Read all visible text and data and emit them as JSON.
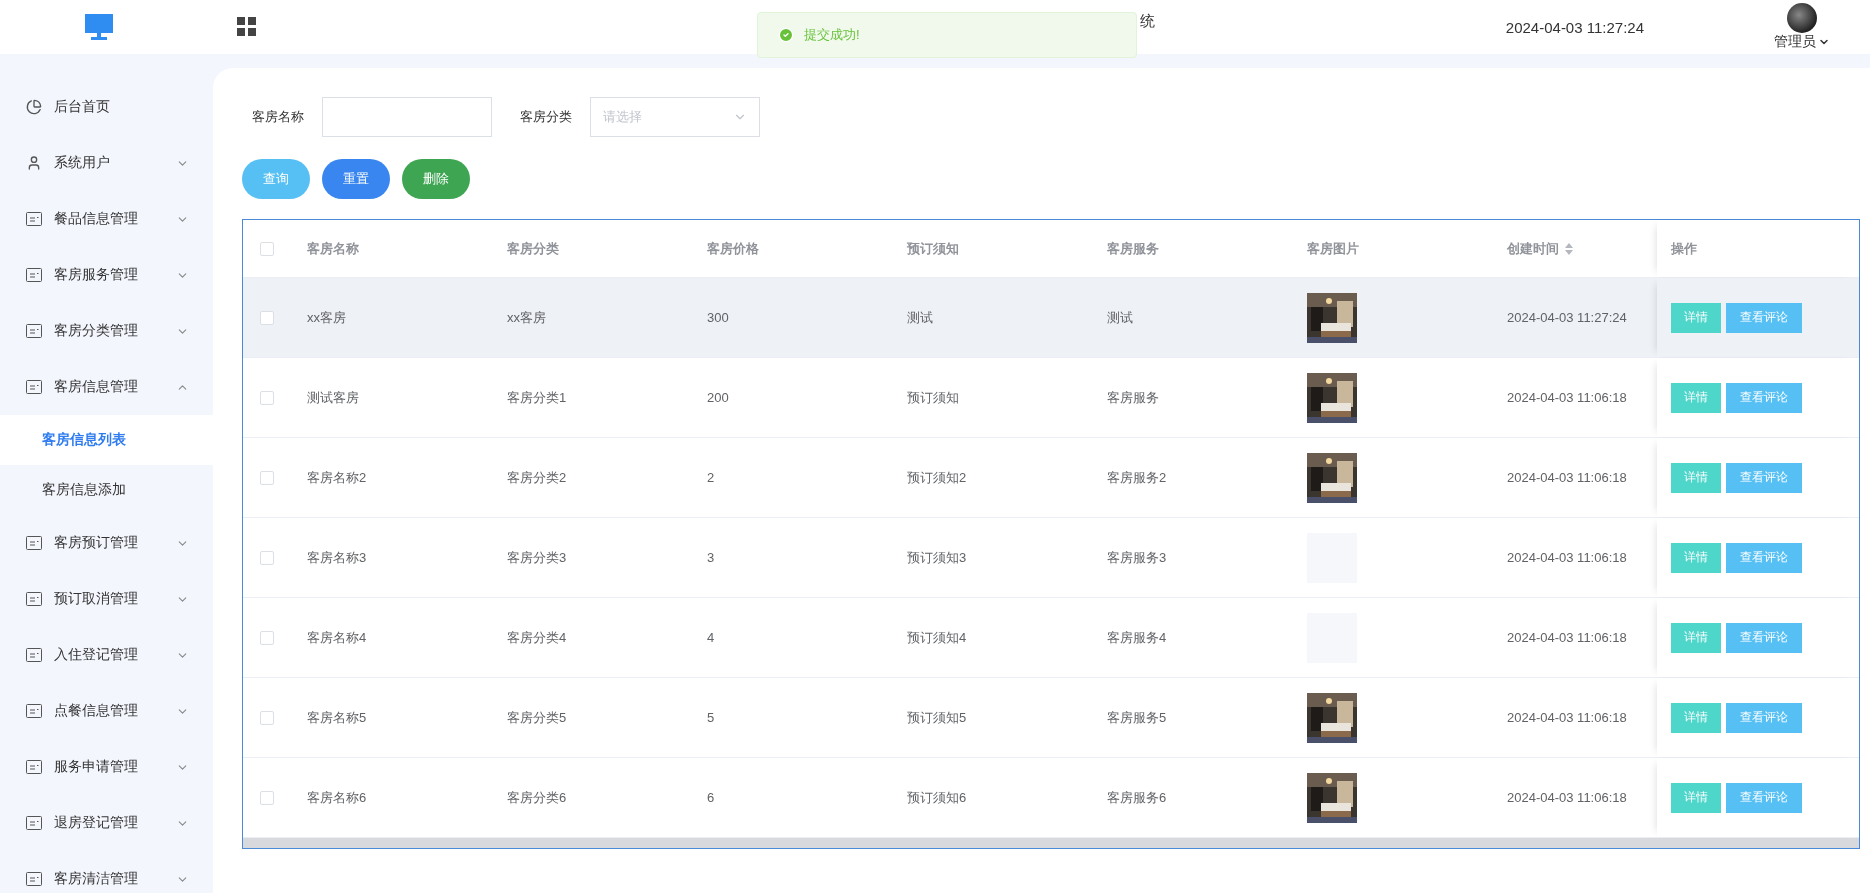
{
  "header": {
    "title_fragment": "统",
    "datetime": "2024-04-03 11:27:24",
    "user": "管理员"
  },
  "toast": {
    "kind": "success",
    "message": "提交成功!"
  },
  "sidebar": {
    "items": [
      {
        "label": "后台首页",
        "kind": "home"
      },
      {
        "label": "系统用户",
        "kind": "user",
        "expanded": false
      },
      {
        "label": "餐品信息管理",
        "kind": "module",
        "expanded": false
      },
      {
        "label": "客房服务管理",
        "kind": "module",
        "expanded": false
      },
      {
        "label": "客房分类管理",
        "kind": "module",
        "expanded": false
      },
      {
        "label": "客房信息管理",
        "kind": "module",
        "expanded": true,
        "children": [
          {
            "label": "客房信息列表",
            "selected": true
          },
          {
            "label": "客房信息添加",
            "selected": false
          }
        ]
      },
      {
        "label": "客房预订管理",
        "kind": "module",
        "expanded": false
      },
      {
        "label": "预订取消管理",
        "kind": "module",
        "expanded": false
      },
      {
        "label": "入住登记管理",
        "kind": "module",
        "expanded": false
      },
      {
        "label": "点餐信息管理",
        "kind": "module",
        "expanded": false
      },
      {
        "label": "服务申请管理",
        "kind": "module",
        "expanded": false
      },
      {
        "label": "退房登记管理",
        "kind": "module",
        "expanded": false
      },
      {
        "label": "客房清洁管理",
        "kind": "module",
        "expanded": false
      }
    ]
  },
  "filters": [
    {
      "label": "客房名称",
      "kind": "text"
    },
    {
      "label": "客房分类",
      "kind": "select",
      "placeholder": "请选择"
    }
  ],
  "buttons": [
    {
      "label": "查询",
      "kind": "query"
    },
    {
      "label": "重置",
      "kind": "reset"
    },
    {
      "label": "删除",
      "kind": "delete"
    }
  ],
  "table": {
    "header_checked": false,
    "columns": [
      {
        "label": "客房名称",
        "sortable": false
      },
      {
        "label": "客房分类",
        "sortable": false
      },
      {
        "label": "客房价格",
        "sortable": false
      },
      {
        "label": "预订须知",
        "sortable": false
      },
      {
        "label": "客房服务",
        "sortable": false
      },
      {
        "label": "客房图片",
        "sortable": false
      },
      {
        "label": "创建时间",
        "sortable": true
      }
    ],
    "actions_label": "操作",
    "rows": [
      {
        "checked": false,
        "highlighted": true,
        "cells": [
          "xx客房",
          "xx客房",
          "300",
          "测试",
          "测试"
        ],
        "image": {
          "kind": "picture"
        },
        "time": "2024-04-03 11:27:24",
        "actions": [
          "详情",
          "查看评论"
        ]
      },
      {
        "checked": false,
        "highlighted": false,
        "cells": [
          "测试客房",
          "客房分类1",
          "200",
          "预订须知",
          "客房服务"
        ],
        "image": {
          "kind": "picture"
        },
        "time": "2024-04-03 11:06:18",
        "actions": [
          "详情",
          "查看评论"
        ]
      },
      {
        "checked": false,
        "highlighted": false,
        "cells": [
          "客房名称2",
          "客房分类2",
          "2",
          "预订须知2",
          "客房服务2"
        ],
        "image": {
          "kind": "picture"
        },
        "time": "2024-04-03 11:06:18",
        "actions": [
          "详情",
          "查看评论"
        ]
      },
      {
        "checked": false,
        "highlighted": false,
        "cells": [
          "客房名称3",
          "客房分类3",
          "3",
          "预订须知3",
          "客房服务3"
        ],
        "image": {
          "kind": "empty"
        },
        "time": "2024-04-03 11:06:18",
        "actions": [
          "详情",
          "查看评论"
        ]
      },
      {
        "checked": false,
        "highlighted": false,
        "cells": [
          "客房名称4",
          "客房分类4",
          "4",
          "预订须知4",
          "客房服务4"
        ],
        "image": {
          "kind": "empty"
        },
        "time": "2024-04-03 11:06:18",
        "actions": [
          "详情",
          "查看评论"
        ]
      },
      {
        "checked": false,
        "highlighted": false,
        "cells": [
          "客房名称5",
          "客房分类5",
          "5",
          "预订须知5",
          "客房服务5"
        ],
        "image": {
          "kind": "picture"
        },
        "time": "2024-04-03 11:06:18",
        "actions": [
          "详情",
          "查看评论"
        ]
      },
      {
        "checked": false,
        "highlighted": false,
        "cells": [
          "客房名称6",
          "客房分类6",
          "6",
          "预订须知6",
          "客房服务6"
        ],
        "image": {
          "kind": "picture"
        },
        "time": "2024-04-03 11:06:18",
        "actions": [
          "详情",
          "查看评论"
        ]
      }
    ]
  }
}
